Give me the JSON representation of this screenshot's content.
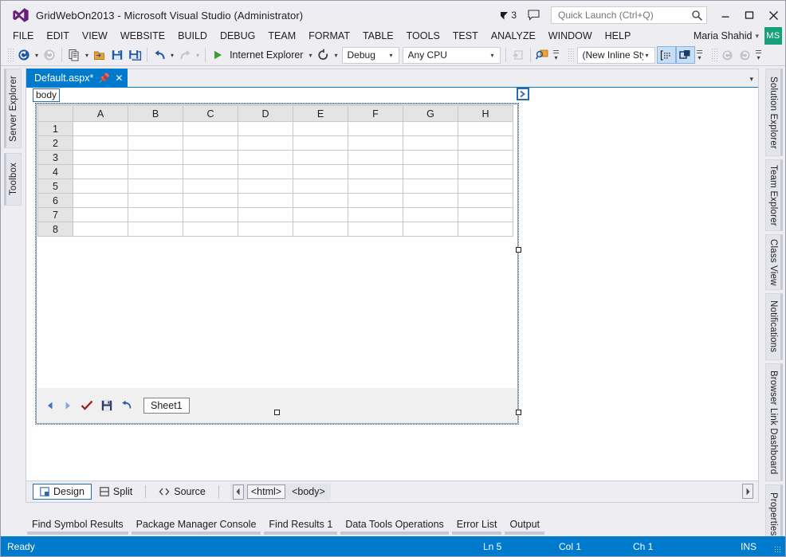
{
  "window": {
    "title": "GridWebOn2013 - Microsoft Visual Studio (Administrator)",
    "logo_icon": "visual-studio-logo",
    "minimize_icon": "minimize-icon",
    "maximize_icon": "maximize-icon",
    "close_icon": "close-icon",
    "notification_count": "3",
    "notification_icon": "flag-icon",
    "feedback_icon": "feedback-speech-bubble-icon"
  },
  "quick_launch": {
    "placeholder": "Quick Launch (Ctrl+Q)",
    "value": "",
    "icon": "search-icon"
  },
  "menubar": {
    "items": [
      {
        "label": "FILE"
      },
      {
        "label": "EDIT"
      },
      {
        "label": "VIEW"
      },
      {
        "label": "WEBSITE"
      },
      {
        "label": "BUILD"
      },
      {
        "label": "DEBUG"
      },
      {
        "label": "TEAM"
      },
      {
        "label": "FORMAT"
      },
      {
        "label": "TABLE"
      },
      {
        "label": "TOOLS"
      },
      {
        "label": "TEST"
      },
      {
        "label": "ANALYZE"
      },
      {
        "label": "WINDOW"
      },
      {
        "label": "HELP"
      }
    ],
    "user_name": "Maria Shahid",
    "user_initials": "MS",
    "user_caret": "chevron-down-icon"
  },
  "toolbar": {
    "navigate_back_icon": "navigate-back-icon",
    "navigate_forward_icon": "navigate-forward-icon",
    "new_project_icon": "new-project-icon",
    "open_file_icon": "open-file-icon",
    "save_icon": "save-icon",
    "save_all_icon": "save-all-icon",
    "undo_icon": "undo-icon",
    "redo_icon": "redo-icon",
    "start_icon": "start-debug-play-icon",
    "start_label": "Internet Explorer",
    "refresh_icon": "refresh-icon",
    "configuration": "Debug",
    "platform": "Any CPU",
    "step_icon": "step-into-icon",
    "find_icon": "find-in-files-icon",
    "style_value": "(New Inline Style",
    "style_placeholder": "(New Inline Style",
    "css_target_icon": "css-target-rule-icon",
    "style_app_icon": "style-application-icon",
    "nav_back_small_icon": "nav-back-small-icon",
    "nav_fwd_small_icon": "nav-forward-small-icon"
  },
  "left_dock": {
    "items": [
      {
        "label": "Server Explorer"
      },
      {
        "label": "Toolbox"
      }
    ]
  },
  "right_dock": {
    "items": [
      {
        "label": "Solution Explorer"
      },
      {
        "label": "Team Explorer"
      },
      {
        "label": "Class View"
      },
      {
        "label": "Notifications"
      },
      {
        "label": "Browser Link Dashboard"
      },
      {
        "label": "Properties"
      }
    ]
  },
  "document": {
    "tab_label": "Default.aspx*",
    "tab_pin_icon": "pin-icon",
    "tab_close_icon": "close-icon",
    "tabstrip_menu_icon": "chevron-down-icon",
    "tag_selector": "body",
    "smart_tag_icon": "smart-tag-chevron-icon"
  },
  "grid_control": {
    "corner_label": "",
    "columns": [
      "A",
      "B",
      "C",
      "D",
      "E",
      "F",
      "G",
      "H"
    ],
    "rows": [
      {
        "header": "1",
        "cells": [
          "",
          "",
          "",
          "",
          "",
          "",
          "",
          ""
        ]
      },
      {
        "header": "2",
        "cells": [
          "",
          "",
          "",
          "",
          "",
          "",
          "",
          ""
        ]
      },
      {
        "header": "3",
        "cells": [
          "",
          "",
          "",
          "",
          "",
          "",
          "",
          ""
        ]
      },
      {
        "header": "4",
        "cells": [
          "",
          "",
          "",
          "",
          "",
          "",
          "",
          ""
        ]
      },
      {
        "header": "5",
        "cells": [
          "",
          "",
          "",
          "",
          "",
          "",
          "",
          ""
        ]
      },
      {
        "header": "6",
        "cells": [
          "",
          "",
          "",
          "",
          "",
          "",
          "",
          ""
        ]
      },
      {
        "header": "7",
        "cells": [
          "",
          "",
          "",
          "",
          "",
          "",
          "",
          ""
        ]
      },
      {
        "header": "8",
        "cells": [
          "",
          "",
          "",
          "",
          "",
          "",
          "",
          ""
        ]
      }
    ],
    "sheet_bar": {
      "prev_icon": "previous-sheet-arrow-icon",
      "next_icon": "next-sheet-arrow-icon",
      "submit_icon": "submit-checkmark-icon",
      "save_icon": "save-floppy-icon",
      "undo_icon": "undo-arrow-icon",
      "active_sheet": "Sheet1"
    }
  },
  "view_bar": {
    "design_label": "Design",
    "design_icon": "design-view-icon",
    "split_label": "Split",
    "split_icon": "split-view-icon",
    "source_label": "Source",
    "source_icon": "source-view-icon",
    "tag_nav_prev_icon": "tag-nav-prev-icon",
    "tag_nav_next_icon": "tag-nav-next-icon",
    "tags": [
      {
        "label": "<html>",
        "selected": true
      },
      {
        "label": "<body>",
        "selected": false
      }
    ]
  },
  "bottom_tabs": {
    "items": [
      {
        "label": "Find Symbol Results"
      },
      {
        "label": "Package Manager Console"
      },
      {
        "label": "Find Results 1"
      },
      {
        "label": "Data Tools Operations"
      },
      {
        "label": "Error List"
      },
      {
        "label": "Output"
      }
    ]
  },
  "statusbar": {
    "status": "Ready",
    "line": "Ln 5",
    "column": "Col 1",
    "character": "Ch 1",
    "insert_mode": "INS",
    "resize_grip_icon": "resize-grip-icon"
  },
  "colors": {
    "accent": "#007acc",
    "chrome": "#eeeef2",
    "avatar": "#16a07c",
    "vs_logo": "#68217a",
    "play_green": "#3f9c35",
    "check_red": "#a31515",
    "save_blue": "#1e5aa8"
  }
}
